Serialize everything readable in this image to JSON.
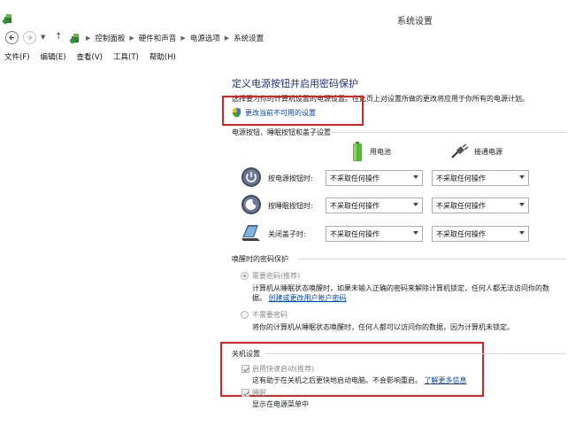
{
  "window": {
    "title": "系统设置"
  },
  "breadcrumb": [
    "控制面板",
    "硬件和声音",
    "电源选项",
    "系统设置"
  ],
  "menu": [
    "文件(F)",
    "编辑(E)",
    "查看(V)",
    "工具(T)",
    "帮助(H)"
  ],
  "main": {
    "heading": "定义电源按钮并启用密码保护",
    "description": "选择要为你的计算机设置的电源设置。在此页上对设置所做的更改将应用于你所有的电源计划。",
    "change_link": "更改当前不可用的设置"
  },
  "power_buttons": {
    "section_title": "电源按钮、睡眠按钮和盖子设置",
    "col_battery": "用电池",
    "col_plugged": "接通电源",
    "rows": [
      {
        "label": "按电源按钮时:",
        "battery": "不采取任何操作",
        "plugged": "不采取任何操作"
      },
      {
        "label": "按睡眠按钮时:",
        "battery": "不采取任何操作",
        "plugged": "不采取任何操作"
      },
      {
        "label": "关闭盖子时:",
        "battery": "不采取任何操作",
        "plugged": "不采取任何操作"
      }
    ]
  },
  "wake_password": {
    "section_title": "唤醒时的密码保护",
    "opt1_label": "需要密码(推荐)",
    "opt1_desc_line1": "计算机从睡眠状态唤醒时，如果未输入正确的密码来解除计算机锁定，任何人都无法访问你的数",
    "opt1_desc_line2_prefix": "据。",
    "opt1_link": "创建或更改用户帐户密码",
    "opt2_label": "不需要密码",
    "opt2_desc": "将你的计算机从睡眠状态唤醒时，任何人都可以访问你的数据，因为计算机未锁定。"
  },
  "shutdown": {
    "section_title": "关机设置",
    "fast_startup_label": "启用快速启动(推荐)",
    "fast_startup_desc": "这有助于在关机之后更快地启动电脑。不会影响重启。",
    "learn_more": "了解更多信息",
    "sleep_label": "睡眠",
    "sleep_desc": "显示在电源菜单中"
  },
  "colors": {
    "accent_link": "#0645ad",
    "heading": "#1e3287",
    "highlight_box": "#e02020"
  }
}
